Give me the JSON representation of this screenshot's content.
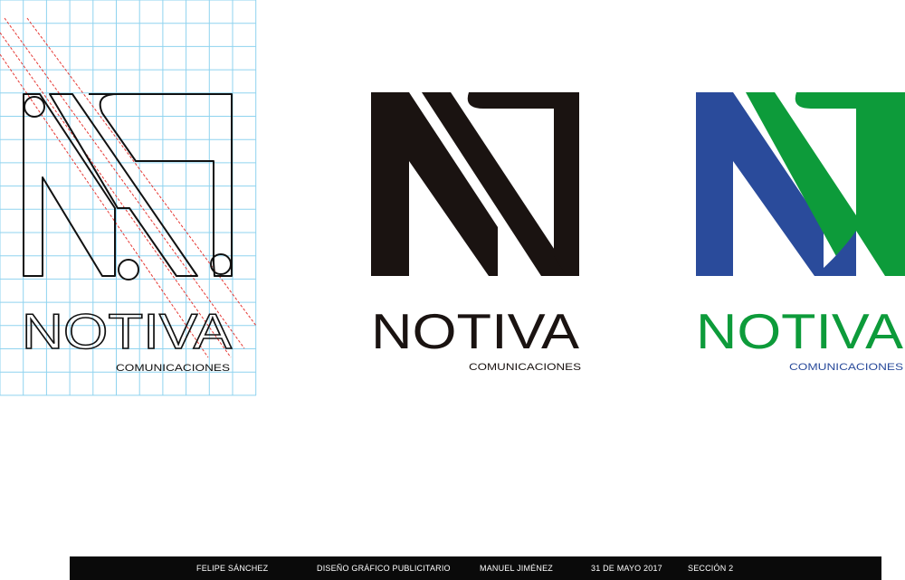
{
  "logo": {
    "name": "NOTIVA",
    "tagline": "COMUNICACIONES"
  },
  "colors": {
    "grid_line": "#8fd3ef",
    "guide_line": "#e53935",
    "black": "#1a1311",
    "blue": "#2a4b9b",
    "green": "#0d9b3a"
  },
  "footer": {
    "author": "FELIPE SÁNCHEZ",
    "course": "DISEÑO GRÁFICO PUBLICITARIO",
    "teacher": "MANUEL JIMÉNEZ",
    "date": "31 DE MAYO 2017",
    "section": "SECCIÓN 2"
  }
}
